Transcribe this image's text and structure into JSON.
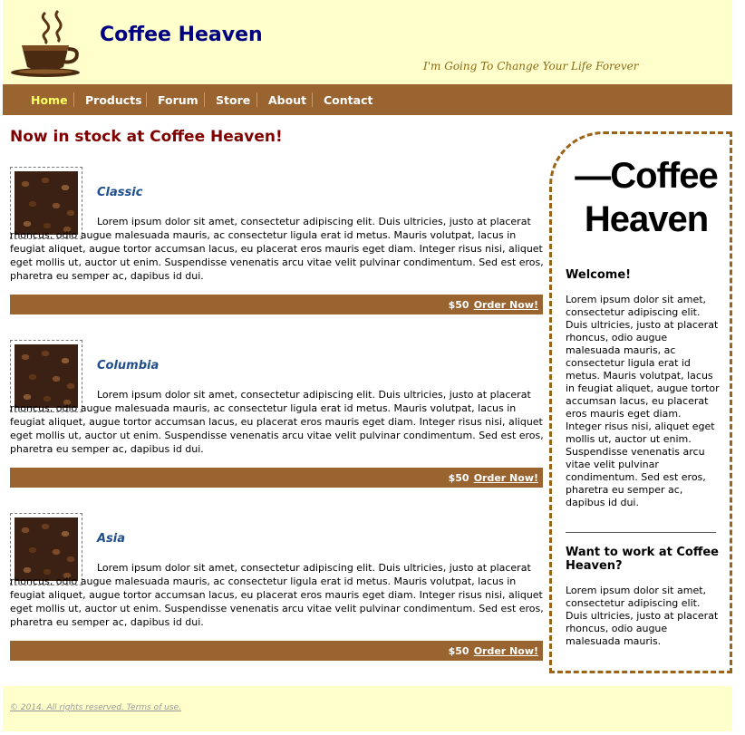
{
  "header": {
    "title": "Coffee Heaven",
    "tagline": "I'm Going To Change Your Life Forever",
    "logo_icon": "coffee-cup-icon"
  },
  "nav": {
    "items": [
      {
        "label": "Home",
        "active": true
      },
      {
        "label": "Products",
        "active": false
      },
      {
        "label": "Forum",
        "active": false
      },
      {
        "label": "Store",
        "active": false
      },
      {
        "label": "About",
        "active": false
      },
      {
        "label": "Contact",
        "active": false
      }
    ]
  },
  "main": {
    "heading": "Now in stock at Coffee Heaven!",
    "products": [
      {
        "name": "Classic",
        "description": "Lorem ipsum dolor sit amet, consectetur adipiscing elit. Duis ultricies, justo at placerat rhoncus, odio augue malesuada mauris, ac consectetur ligula erat id metus. Mauris volutpat, lacus in feugiat aliquet, augue tortor accumsan lacus, eu placerat eros mauris eget diam. Integer risus nisi, aliquet eget mollis ut, auctor ut enim. Suspendisse venenatis arcu vitae velit pulvinar condimentum. Sed est eros, pharetra eu semper ac, dapibus id dui.",
        "price": "$50",
        "order_label": "Order Now!"
      },
      {
        "name": "Columbia",
        "description": "Lorem ipsum dolor sit amet, consectetur adipiscing elit. Duis ultricies, justo at placerat rhoncus, odio augue malesuada mauris, ac consectetur ligula erat id metus. Mauris volutpat, lacus in feugiat aliquet, augue tortor accumsan lacus, eu placerat eros mauris eget diam. Integer risus nisi, aliquet eget mollis ut, auctor ut enim. Suspendisse venenatis arcu vitae velit pulvinar condimentum. Sed est eros, pharetra eu semper ac, dapibus id dui.",
        "price": "$50",
        "order_label": "Order Now!"
      },
      {
        "name": "Asia",
        "description": "Lorem ipsum dolor sit amet, consectetur adipiscing elit. Duis ultricies, justo at placerat rhoncus, odio augue malesuada mauris, ac consectetur ligula erat id metus. Mauris volutpat, lacus in feugiat aliquet, augue tortor accumsan lacus, eu placerat eros mauris eget diam. Integer risus nisi, aliquet eget mollis ut, auctor ut enim. Suspendisse venenatis arcu vitae velit pulvinar condimentum. Sed est eros, pharetra eu semper ac, dapibus id dui.",
        "price": "$50",
        "order_label": "Order Now!"
      }
    ]
  },
  "sidebar": {
    "logo_text": "—Coffee Heaven",
    "welcome_heading": "Welcome!",
    "welcome_text": "Lorem ipsum dolor sit amet, consectetur adipiscing elit. Duis ultricies, justo at placerat rhoncus, odio augue malesuada mauris, ac consectetur ligula erat id metus. Mauris volutpat, lacus in feugiat aliquet, augue tortor accumsan lacus, eu placerat eros mauris eget diam. Integer risus nisi, aliquet eget mollis ut, auctor ut enim. Suspendisse venenatis arcu vitae velit pulvinar condimentum. Sed est eros, pharetra eu semper ac, dapibus id dui.",
    "jobs_heading": "Want to work at Coffee Heaven?",
    "jobs_text": "Lorem ipsum dolor sit amet, consectetur adipiscing elit. Duis ultricies, justo at placerat rhoncus, odio augue malesuada mauris."
  },
  "footer": {
    "text": "© 2014. All rights reserved. Terms of use."
  },
  "colors": {
    "header_bg": "#ffffcc",
    "nav_bg": "#9a6430",
    "title": "#000080",
    "heading": "#800000"
  }
}
